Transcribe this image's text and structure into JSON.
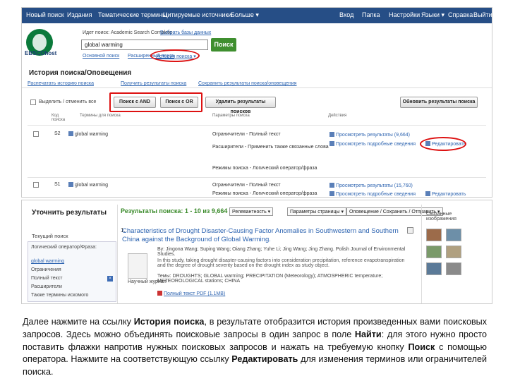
{
  "topnav": {
    "items": [
      "Новый поиск",
      "Издания",
      "Тематические термины",
      "Цитируемые источники",
      "Больше ▾"
    ],
    "right": [
      "Вход",
      "Папка",
      "Настройки",
      "Языки ▾",
      "Справка",
      "Выйти"
    ]
  },
  "logo": "EBSCOhost",
  "search": {
    "scope_label": "Идет поиск: Academic Search Complete",
    "choose_db": "Выбрать базы данных",
    "value": "global warming",
    "button": "Поиск",
    "basic": "Основной поиск",
    "advanced": "Расширенный поиск",
    "history_link": "История поиска ▾"
  },
  "history": {
    "title": "История поиска/Оповещения",
    "bar_left": "Распечатать историю поиска",
    "bar_mid1": "Получить результаты поиска",
    "bar_mid2": "Сохранить результаты поиска/оповещения",
    "select_all": "Выделить / отменить все",
    "btn_and": "Поиск с AND",
    "btn_or": "Поиск с OR",
    "btn_delete": "Удалить результаты поисков",
    "btn_refresh": "Обновить результаты поиска",
    "headers": [
      "Код поиска",
      "Термины для поиска",
      "Параметры поиска",
      "Действия"
    ],
    "rows": [
      {
        "code": "S2",
        "term": "global warming",
        "params": [
          "Ограничители - Полный текст",
          "Расширители - Применить также связанные слова",
          "Режимы поиска - Логический оператор/фраза"
        ],
        "view": "Просмотреть результаты (9,664)",
        "detail": "Просмотреть подробные сведения",
        "edit": "Редактировать"
      },
      {
        "code": "S1",
        "term": "global warming",
        "params": [
          "Ограничители - Полный текст",
          "Режимы поиска - Логический оператор/фраза"
        ],
        "view": "Просмотреть результаты (15,760)",
        "detail": "Просмотреть подробные сведения",
        "edit": "Редактировать"
      }
    ]
  },
  "results": {
    "refine_title": "Уточнить результаты",
    "current_search": "Текущий поиск",
    "boolean_label": "Логический оператор/Фраза:",
    "boolean_value": "global warming",
    "limiters": "Ограничения",
    "fulltext": "Полный текст",
    "expanders": "Расширители",
    "expander_value": "Также термины искомого",
    "header": "Результаты поиска: 1 - 10 из 9,664",
    "sort": "Релевантность ▾",
    "options": "Параметры страницы ▾",
    "alert": "Оповещение / Сохранить / Отправить ▾",
    "result_number": "1.",
    "result_title": "Characteristics of Drought Disaster-Causing Factor Anomalies in Southwestern and Southern China against the Background of Global Warming.",
    "result_meta": "By: Jingona Wang; Suping Wang; Oiang Zhang; Yuhe Li; Jing Wang; Jing Zhang. Polish Journal of Environmental Studies.",
    "result_abstract": "In this study, taking drought disaster-causing factors into consideration precipitation, reference evapotranspiration and the degree of drought severity based on the drought index as study object.",
    "result_subjects": "Темы: DROUGHTS; GLOBAL warming; PRECIPITATION (Meteorology); ATMOSPHERIC temperature; METEOROLOGICAL stations; CHINA",
    "result_link": "Полный текст PDF (1.1MB)",
    "thumb_label": "Научный журнал",
    "related_images": "Связанные изображения"
  },
  "caption": {
    "p1": "Далее нажмите на ссылку ",
    "b1": "История поиска",
    "p2": ", в результате отобразится история произведенных вами поисковых запросов. Здесь можно объединять поисковые запросы в один запрос в поле ",
    "b2": "Найти",
    "p3": ": для этого нужно просто поставить флажки напротив нужных поисковых запросов и нажать на требуемую кнопку ",
    "b3": "Поиск",
    "p4": " с помощью оператора. Нажмите на соответствующую ссылку ",
    "b4": "Редактировать",
    "p5": " для изменения терминов или ограничителей поиска."
  },
  "colors": {
    "nav": "#264e86",
    "accent_green": "#3f8f2f",
    "highlight_red": "#d11111",
    "link": "#2c63b0"
  }
}
